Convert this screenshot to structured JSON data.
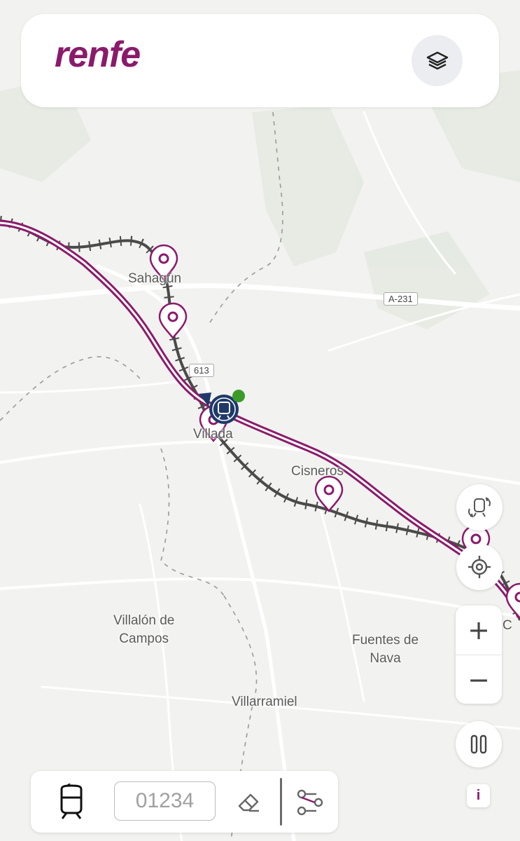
{
  "header": {
    "brand": "renfe",
    "layers_icon": "layers-icon"
  },
  "map": {
    "places": [
      {
        "key": "sahagun",
        "name": "Sahagún"
      },
      {
        "key": "villada",
        "name": "Villada"
      },
      {
        "key": "cisneros",
        "name": "Cisneros"
      },
      {
        "key": "villalon",
        "name": "Villalón de\nCampos"
      },
      {
        "key": "fuentes",
        "name": "Fuentes de\nNava"
      },
      {
        "key": "villarramiel",
        "name": "Villarramiel"
      },
      {
        "key": "c_edge",
        "name": "C"
      }
    ],
    "roads": [
      {
        "key": "a231",
        "name": "A-231"
      },
      {
        "key": "p613",
        "name": "613"
      }
    ],
    "station_marker_icon": "map-pin-icon",
    "train_icon": "train-icon",
    "colors": {
      "brand": "#8a1b6b",
      "railway": "#4a4a4a",
      "route": "#8a1b6b",
      "train_marker": "#1f3a68",
      "status_live": "#3c9a2b"
    }
  },
  "controls": {
    "rotate_icon": "rotate-3d-train-icon",
    "locate_icon": "locate-icon",
    "zoom_in_label": "+",
    "zoom_out_label": "−",
    "pause_icon": "pause-icon",
    "info_label": "i"
  },
  "bottom_bar": {
    "train_mode_icon": "train-icon",
    "train_number_placeholder": "01234",
    "clear_icon": "eraser-icon",
    "route_filter_icon": "route-icon"
  }
}
